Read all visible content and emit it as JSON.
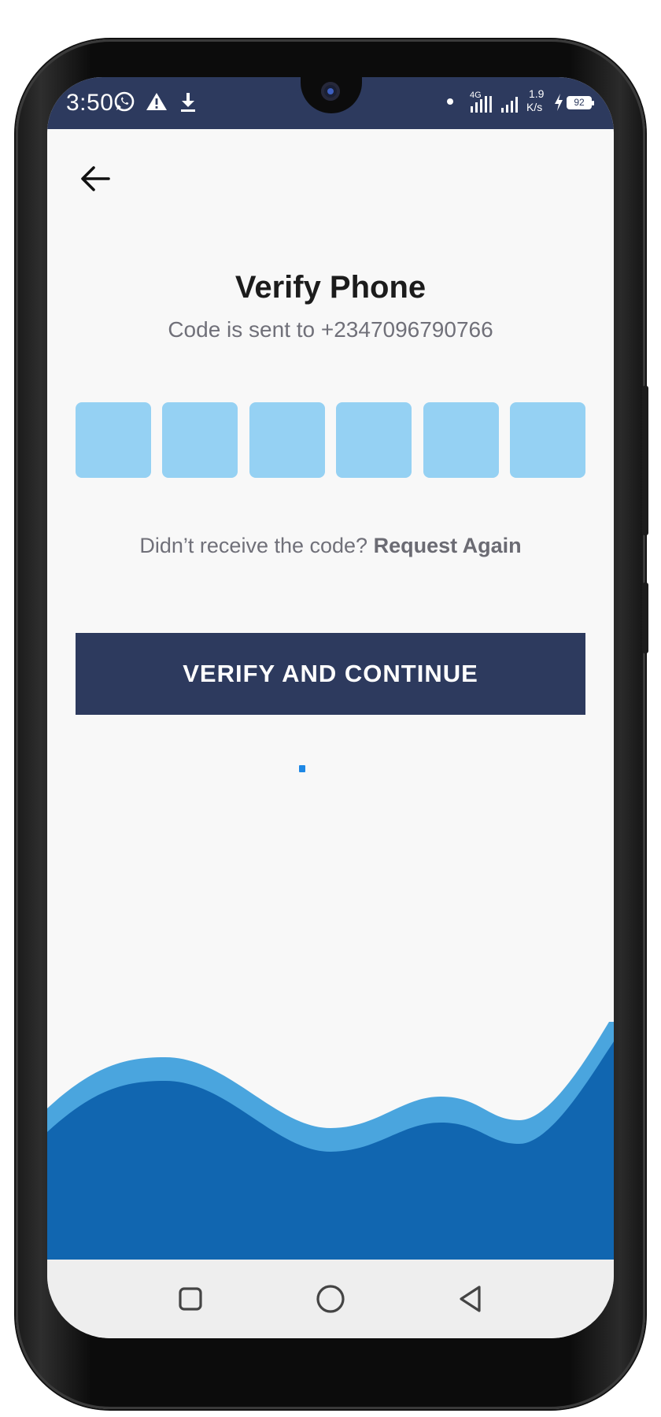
{
  "status_bar": {
    "time": "3:50",
    "network_type": "4G",
    "speed_value": "1.9",
    "speed_unit": "K/s",
    "battery": "92",
    "icons": [
      "whatsapp-icon",
      "warning-icon",
      "download-icon",
      "dot-icon",
      "signal-icon",
      "signal-icon",
      "charging-icon",
      "battery-icon"
    ]
  },
  "screen": {
    "title": "Verify Phone",
    "subtitle": "Code is sent to +2347096790766",
    "otp": {
      "digits": 6,
      "values": [
        "",
        "",
        "",
        "",
        "",
        ""
      ]
    },
    "resend_prompt": "Didn’t receive the code?",
    "resend_link": "Request Again",
    "cta_label": "VERIFY AND CONTINUE"
  },
  "navigation": {
    "back_icon": "arrow-left-icon",
    "nav_icons": [
      "recents-square-icon",
      "home-circle-icon",
      "back-triangle-icon"
    ]
  },
  "colors": {
    "primary": "#2d3a5e",
    "otp_box": "#95d1f3",
    "wave_light": "#4aa5de",
    "wave_dark": "#1166b0",
    "spinner": "#1e88e5",
    "background": "#f8f8f8"
  }
}
